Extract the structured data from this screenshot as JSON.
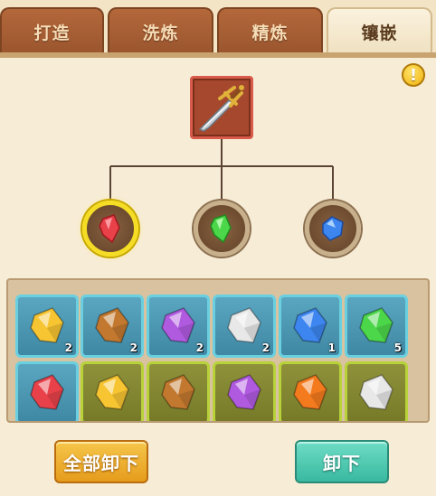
{
  "tabs": [
    {
      "label": "打造",
      "active": false
    },
    {
      "label": "洗炼",
      "active": false
    },
    {
      "label": "精炼",
      "active": false
    },
    {
      "label": "镶嵌",
      "active": true
    }
  ],
  "info_icon": "!",
  "equipment": {
    "icon": "sword-icon"
  },
  "sockets": [
    {
      "gem": "red",
      "selected": true
    },
    {
      "gem": "green",
      "selected": false
    },
    {
      "gem": "blue",
      "selected": false
    }
  ],
  "gems": [
    {
      "color": "yellow",
      "count": "2",
      "frame": "teal"
    },
    {
      "color": "orange-brown",
      "count": "2",
      "frame": "teal"
    },
    {
      "color": "purple",
      "count": "2",
      "frame": "teal"
    },
    {
      "color": "white",
      "count": "2",
      "frame": "teal"
    },
    {
      "color": "blue",
      "count": "1",
      "frame": "teal"
    },
    {
      "color": "green",
      "count": "5",
      "frame": "teal"
    },
    {
      "color": "red",
      "count": "",
      "frame": "teal"
    },
    {
      "color": "yellow",
      "count": "",
      "frame": "olive"
    },
    {
      "color": "orange-brown",
      "count": "",
      "frame": "olive"
    },
    {
      "color": "purple",
      "count": "",
      "frame": "olive"
    },
    {
      "color": "orange",
      "count": "",
      "frame": "olive"
    },
    {
      "color": "white",
      "count": "",
      "frame": "olive"
    }
  ],
  "buttons": {
    "unload_all": "全部卸下",
    "unload": "卸下"
  },
  "colors": {
    "yellow": "#f7c531",
    "orange-brown": "#c2782e",
    "purple": "#b05ae0",
    "white": "#e8e8e8",
    "blue": "#3d86f0",
    "green": "#4cd64a",
    "red": "#e8414a",
    "orange": "#f47a1e"
  }
}
